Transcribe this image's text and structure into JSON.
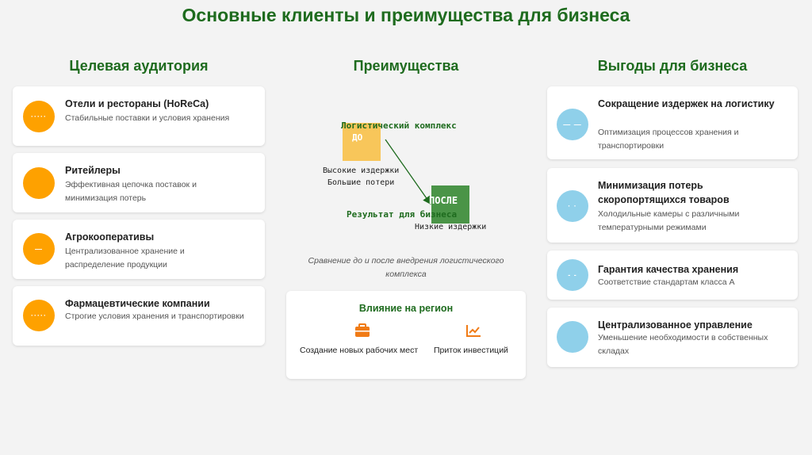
{
  "title": "Основные клиенты и преимущества для бизнеса",
  "columns": {
    "audience": "Целевая аудитория",
    "advantages": "Преимущества",
    "benefits": "Выгоды для бизнеса"
  },
  "audience": [
    {
      "icon": "hotel-icon",
      "icon_text": "·····",
      "title": "Отели и рестораны (HoReCa)",
      "desc": "Стабильные поставки и условия хранения"
    },
    {
      "icon": "retail-icon",
      "icon_text": "",
      "title": "Ритейлеры",
      "desc": "Эффективная цепочка поставок и минимизация потерь"
    },
    {
      "icon": "agro-icon",
      "icon_text": "—",
      "title": "Агрокооперативы",
      "desc": "Централизованное хранение и распределение продукции"
    },
    {
      "icon": "pharma-icon",
      "icon_text": "·····",
      "title": "Фармацевтические компании",
      "desc": "Строгие условия хранения и транспортировки"
    }
  ],
  "advantages": {
    "complex_label": "Логистический комплекс",
    "before_label": "ДО",
    "before_line1": "Высокие издержки",
    "before_line2": "Большие потери",
    "after_label": "ПОСЛЕ",
    "result_label": "Результат для бизнеса",
    "after_line": "Низкие издержки",
    "caption": "Сравнение до и после внедрения логистического комплекса",
    "region": {
      "title": "Влияние на регион",
      "items": [
        {
          "icon": "briefcase-icon",
          "label": "Создание новых рабочих мест"
        },
        {
          "icon": "chart-growth-icon",
          "label": "Приток инвестиций"
        }
      ]
    }
  },
  "benefits": [
    {
      "icon": "logistics-icon",
      "icon_text": "— —",
      "title": "Сокращение издержек на логистику",
      "desc": "Оптимизация процессов хранения и транспортировки"
    },
    {
      "icon": "cold-storage-icon",
      "icon_text": "· ·",
      "title": "Минимизация потерь скоропортящихся товаров",
      "desc": "Холодильные камеры с различными температурными режимами"
    },
    {
      "icon": "quality-icon",
      "icon_text": "- -",
      "title": "Гарантия качества хранения",
      "desc": "Соответствие стандартам класса А"
    },
    {
      "icon": "management-icon",
      "icon_text": "",
      "title": "Централизованное управление",
      "desc": "Уменьшение необходимости в собственных складах"
    }
  ],
  "colors": {
    "accent_green": "#1e6b1e",
    "orange": "#fea100",
    "light_blue": "#8fd0ea",
    "after_green": "#4a9447",
    "before_yellow": "#f8c65a"
  }
}
